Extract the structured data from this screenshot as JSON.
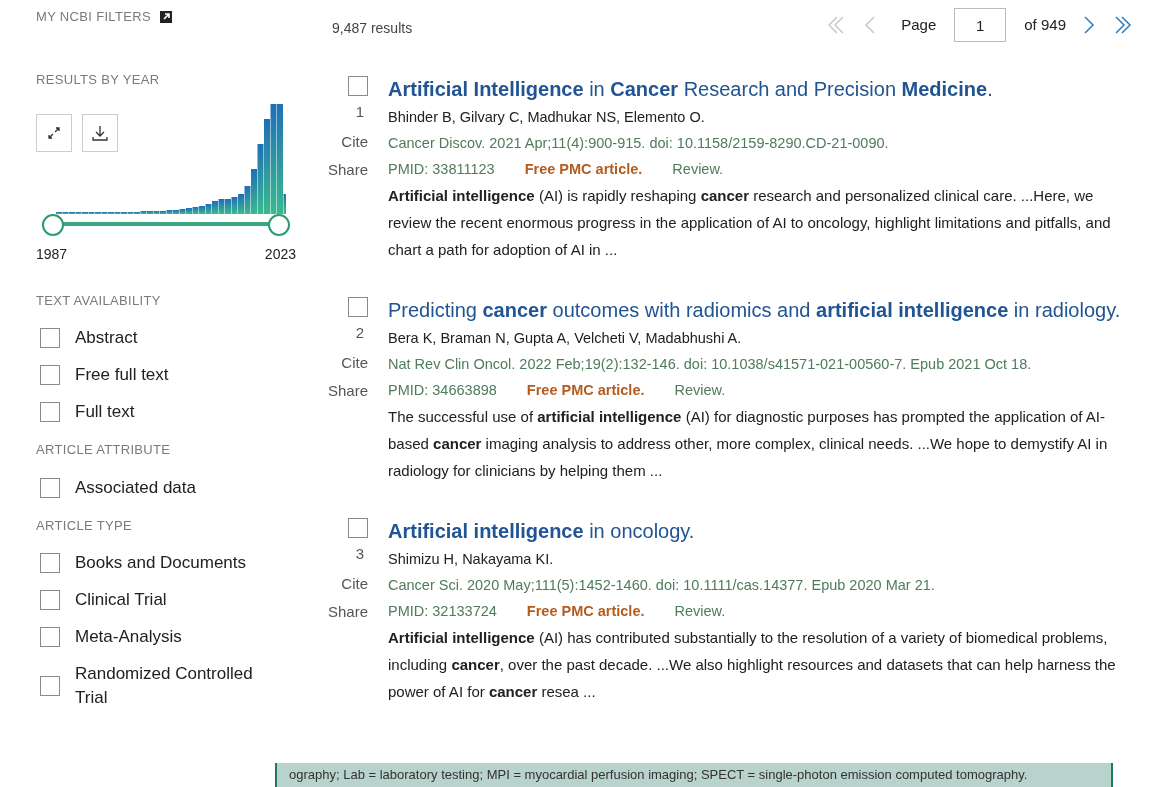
{
  "sidebar": {
    "my_filters": {
      "label": "MY NCBI FILTERS"
    },
    "results_by_year": {
      "heading": "RESULTS BY YEAR",
      "range_start": "1987",
      "range_end": "2023"
    },
    "groups": [
      {
        "heading": "TEXT AVAILABILITY",
        "options": [
          {
            "label": "Abstract",
            "checked": false
          },
          {
            "label": "Free full text",
            "checked": false
          },
          {
            "label": "Full text",
            "checked": false
          }
        ]
      },
      {
        "heading": "ARTICLE ATTRIBUTE",
        "options": [
          {
            "label": "Associated data",
            "checked": false
          }
        ]
      },
      {
        "heading": "ARTICLE TYPE",
        "options": [
          {
            "label": "Books and Documents",
            "checked": false
          },
          {
            "label": "Clinical Trial",
            "checked": false
          },
          {
            "label": "Meta-Analysis",
            "checked": false
          },
          {
            "label": "Randomized Controlled Trial",
            "checked": false
          }
        ]
      }
    ]
  },
  "results_count": "9,487 results",
  "pagination": {
    "page_label": "Page",
    "page": "1",
    "of_label": "of 949",
    "buttons": [
      {
        "kind": "first",
        "disabled": true
      },
      {
        "kind": "prev",
        "disabled": true
      },
      {
        "kind": "next",
        "disabled": false
      },
      {
        "kind": "last",
        "disabled": false
      }
    ]
  },
  "results": [
    {
      "number": "1",
      "checked": false,
      "cite": "Cite",
      "share": "Share",
      "title": "**Artificial Intelligence** in **Cancer** Research and Precision **Medicine**.",
      "authors": "Bhinder B, Gilvary C, Madhukar NS, Elemento O.",
      "citation": "Cancer Discov. 2021 Apr;11(4):900-915. doi: 10.1158/2159-8290.CD-21-0090.",
      "pmid": "PMID: 33811123",
      "free": "Free PMC article.",
      "type": "Review.",
      "snippet": "**Artificial intelligence** (AI) is rapidly reshaping **cancer** research and personalized clinical care. ...Here, we review the recent enormous progress in the application of AI to oncology, highlight limitations and pitfalls, and chart a path for adoption of AI in ..."
    },
    {
      "number": "2",
      "checked": false,
      "cite": "Cite",
      "share": "Share",
      "title": "Predicting **cancer** outcomes with radiomics and **artificial intelligence** in radiology.",
      "authors": "Bera K, Braman N, Gupta A, Velcheti V, Madabhushi A.",
      "citation": "Nat Rev Clin Oncol. 2022 Feb;19(2):132-146. doi: 10.1038/s41571-021-00560-7. Epub 2021 Oct 18.",
      "pmid": "PMID: 34663898",
      "free": "Free PMC article.",
      "type": "Review.",
      "snippet": "The successful use of **artificial intelligence** (AI) for diagnostic purposes has prompted the application of AI-based **cancer** imaging analysis to address other, more complex, clinical needs. ...We hope to demystify AI in radiology for clinicians by helping them ..."
    },
    {
      "number": "3",
      "checked": false,
      "cite": "Cite",
      "share": "Share",
      "title": "**Artificial intelligence** in oncology.",
      "authors": "Shimizu H, Nakayama KI.",
      "citation": "Cancer Sci. 2020 May;111(5):1452-1460. doi: 10.1111/cas.14377. Epub 2020 Mar 21.",
      "pmid": "PMID: 32133724",
      "free": "Free PMC article.",
      "type": "Review.",
      "snippet": "**Artificial intelligence** (AI) has contributed substantially to the resolution of a variety of biomedical problems, including **cancer**, over the past decade. ...We also highlight resources and datasets that can help harness the power of AI for **cancer** resea ..."
    }
  ],
  "overlay_caption": "ography; Lab = laboratory testing; MPI = myocardial perfusion imaging; SPECT = single-photon emission computed tomography."
}
